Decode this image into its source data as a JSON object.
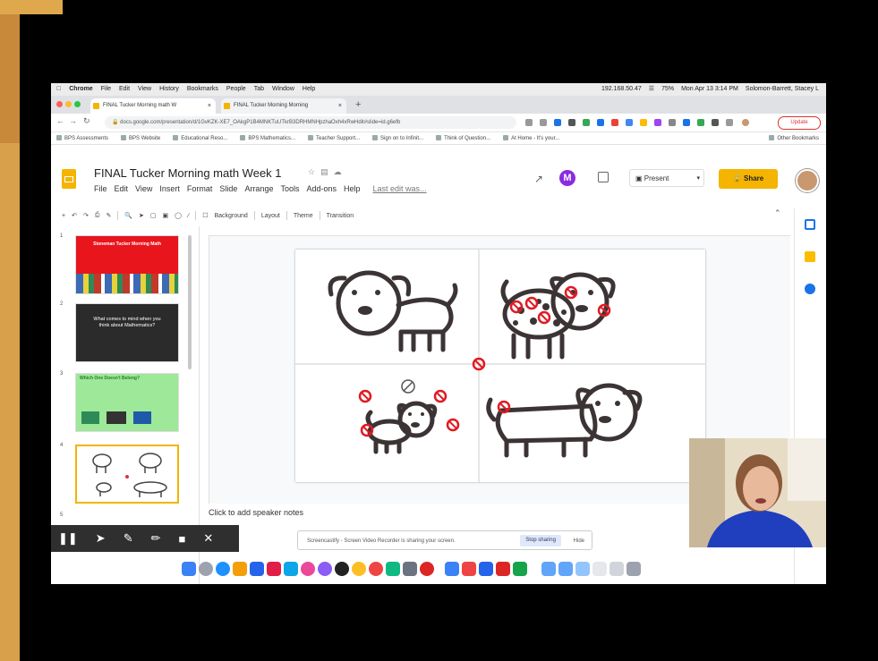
{
  "browser": {
    "menubar": {
      "items": [
        "Chrome",
        "File",
        "Edit",
        "View",
        "History",
        "Bookmarks",
        "People",
        "Tab",
        "Window",
        "Help"
      ],
      "status": [
        "192.168.50.47",
        "75%",
        "Mon Apr 13 3:14 PM",
        "Solomon-Barrett, Stacey L"
      ]
    },
    "tabs": [
      {
        "title": "FINAL Tucker Morning math W",
        "active": true
      },
      {
        "title": "FINAL Tucker Morning Morning",
        "active": false
      }
    ],
    "address": "docs.google.com/presentation/d/1GvKZK-XE7_OAkgP1B4MNKTuUTkrB3DRHMNHpzhaOxh4xRwHdit#slide=id.g6efb",
    "update_label": "Update",
    "bookmarks": [
      "BPS Assessments",
      "BPS Website",
      "Educational Reso...",
      "BPS Mathematics...",
      "Teacher Support...",
      "Sign on to Infinit...",
      "Think of Question...",
      "At Home - It's your...",
      "Other Bookmarks"
    ]
  },
  "slides": {
    "doc_title": "FINAL Tucker Morning math Week 1",
    "menu": [
      "File",
      "Edit",
      "View",
      "Insert",
      "Format",
      "Slide",
      "Arrange",
      "Tools",
      "Add-ons",
      "Help"
    ],
    "last_edit": "Last edit was...",
    "present_label": "Present",
    "share_label": "Share",
    "toolbar": [
      "Background",
      "Layout",
      "Theme",
      "Transition"
    ],
    "thumbnails": [
      {
        "num": "1",
        "title": "Stoneman Tucker Morning Math"
      },
      {
        "num": "2",
        "title": "What comes to mind when you think about Mathematics?"
      },
      {
        "num": "3",
        "title": "Which One Doesn't Belong?"
      },
      {
        "num": "4",
        "title": ""
      }
    ],
    "speaker_notes": "Click to add speaker notes"
  },
  "screen_share": {
    "notice": "Screencastify - Screen Video Recorder is sharing your screen.",
    "stop_label": "Stop sharing",
    "hide_label": "Hide"
  }
}
